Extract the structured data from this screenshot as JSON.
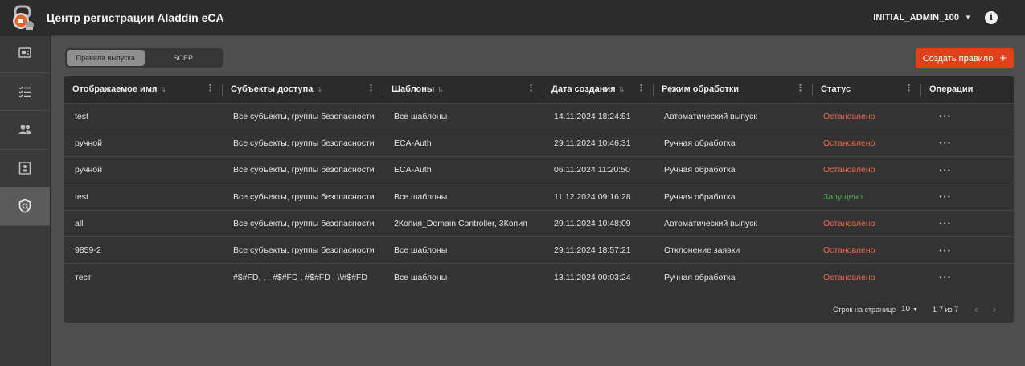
{
  "header": {
    "title": "Центр регистрации Aladdin eCA",
    "user": "INITIAL_ADMIN_100",
    "info_icon": "i"
  },
  "sidebar": {
    "items": [
      {
        "icon": "certificate-icon"
      },
      {
        "icon": "checklist-icon"
      },
      {
        "icon": "users-icon"
      },
      {
        "icon": "template-icon"
      },
      {
        "icon": "shield-rules-icon",
        "active": true
      }
    ]
  },
  "tabs": [
    {
      "label": "Правила выпуска",
      "active": true
    },
    {
      "label": "SCEP",
      "active": false
    }
  ],
  "create_button": {
    "label": "Создать правило",
    "plus": "+"
  },
  "table": {
    "columns": [
      {
        "label": "Отображаемое имя",
        "sortable": true,
        "menu": true
      },
      {
        "label": "Субъекты доступа",
        "sortable": true,
        "menu": true
      },
      {
        "label": "Шаблоны",
        "sortable": true,
        "menu": true
      },
      {
        "label": "Дата создания",
        "sortable": true,
        "menu": true
      },
      {
        "label": "Режим обработки",
        "sortable": false,
        "menu": true
      },
      {
        "label": "Статус",
        "sortable": false,
        "menu": true
      },
      {
        "label": "Операции",
        "sortable": false,
        "menu": false
      }
    ],
    "rows": [
      {
        "name": "test",
        "subjects": "Все субъекты, группы безопасности",
        "templates": "Все шаблоны",
        "date": "14.11.2024 18:24:51",
        "mode": "Автоматический выпуск",
        "status": "Остановлено",
        "running": false,
        "ops": "···"
      },
      {
        "name": "ручной",
        "subjects": "Все субъекты, группы безопасности",
        "templates": "ECA-Auth",
        "date": "29.11.2024 10:46:31",
        "mode": "Ручная обработка",
        "status": "Остановлено",
        "running": false,
        "ops": "···"
      },
      {
        "name": "ручной",
        "subjects": "Все субъекты, группы безопасности",
        "templates": "ECA-Auth",
        "date": "06.11.2024 11:20:50",
        "mode": "Ручная обработка",
        "status": "Остановлено",
        "running": false,
        "ops": "···"
      },
      {
        "name": "test",
        "subjects": "Все субъекты, группы безопасности",
        "templates": "Все шаблоны",
        "date": "11.12.2024 09:16:28",
        "mode": "Ручная обработка",
        "status": "Запущено",
        "running": true,
        "ops": "···"
      },
      {
        "name": "all",
        "subjects": "Все субъекты, группы безопасности",
        "templates": "2Копия_Domain Controller, 3Копия",
        "date": "29.11.2024 10:48:09",
        "mode": "Автоматический выпуск",
        "status": "Остановлено",
        "running": false,
        "ops": "···"
      },
      {
        "name": "9859-2",
        "subjects": "Все субъекты, группы безопасности",
        "templates": "Все шаблоны",
        "date": "29.11.2024 18:57:21",
        "mode": "Отклонение заявки",
        "status": "Остановлено",
        "running": false,
        "ops": "···"
      },
      {
        "name": "тест",
        "subjects": "#$#FD, , , #$#FD , #$#FD , \\\\#$#FD",
        "templates": "Все шаблоны",
        "date": "13.11.2024 00:03:24",
        "mode": "Ручная обработка",
        "status": "Остановлено",
        "running": false,
        "ops": "···"
      }
    ]
  },
  "pagination": {
    "rows_per_page_label": "Строк на странице",
    "rows_per_page_value": "10",
    "range": "1-7 из 7",
    "prev": "‹",
    "next": "›"
  },
  "colors": {
    "accent": "#e0401a",
    "status_stopped": "#f06a4a",
    "status_running": "#4caf50"
  }
}
